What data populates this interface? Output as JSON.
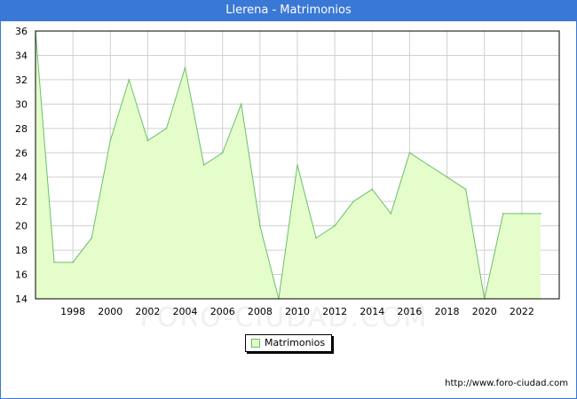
{
  "window": {
    "title": "Llerena - Matrimonios",
    "footer_url": "http://www.foro-ciudad.com",
    "watermark": "FORO-CIUDAD.COM"
  },
  "colors": {
    "title_bar": "#3a78d6",
    "area_fill": "#e4fdcb",
    "area_line": "#6bbf6b",
    "grid": "#d0d0d0"
  },
  "chart_data": {
    "type": "area",
    "title": "Llerena - Matrimonios",
    "xlabel": "",
    "ylabel": "",
    "x": [
      1996,
      1997,
      1998,
      1999,
      2000,
      2001,
      2002,
      2003,
      2004,
      2005,
      2006,
      2007,
      2008,
      2009,
      2010,
      2011,
      2012,
      2013,
      2014,
      2015,
      2016,
      2017,
      2018,
      2019,
      2020,
      2021,
      2022,
      2023
    ],
    "series": [
      {
        "name": "Matrimonios",
        "values": [
          36,
          17,
          17,
          19,
          27,
          32,
          27,
          28,
          33,
          25,
          26,
          30,
          20,
          14,
          25,
          19,
          20,
          22,
          23,
          21,
          26,
          25,
          24,
          23,
          14,
          21,
          21,
          21
        ]
      }
    ],
    "xticks": [
      1998,
      2000,
      2002,
      2004,
      2006,
      2008,
      2010,
      2012,
      2014,
      2016,
      2018,
      2020,
      2022
    ],
    "yticks": [
      14,
      16,
      18,
      20,
      22,
      24,
      26,
      28,
      30,
      32,
      34,
      36
    ],
    "xlim": [
      1996,
      2024
    ],
    "ylim": [
      14,
      36
    ],
    "grid": true,
    "legend_position": "bottom-center"
  }
}
